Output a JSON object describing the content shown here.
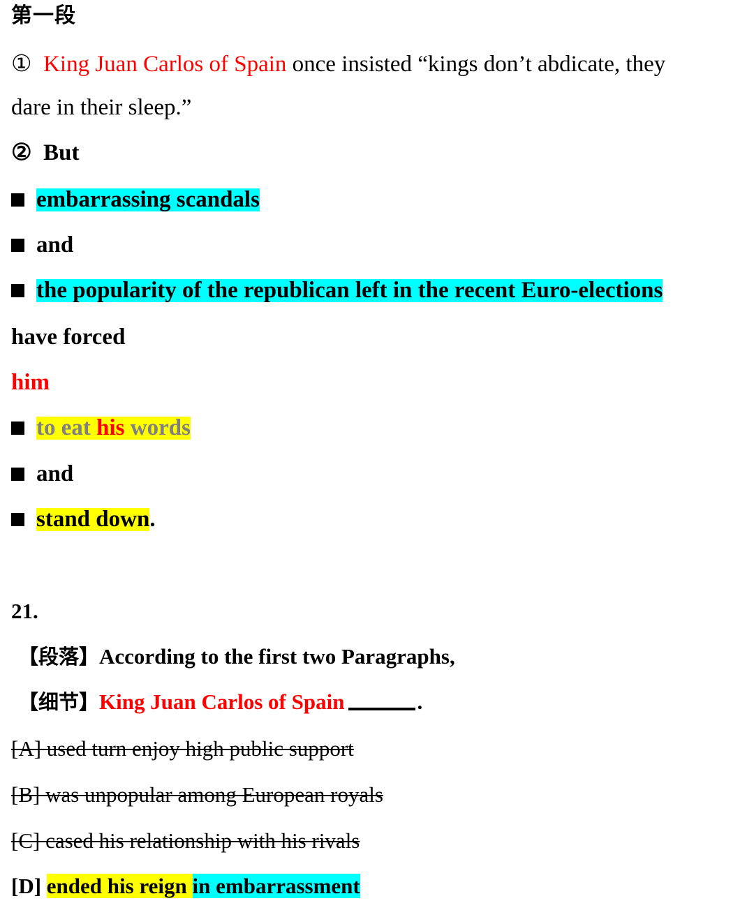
{
  "document": {
    "section_heading": "第一段",
    "colors": {
      "accent_red": "#ff0000",
      "highlight_cyan": "#00ffff",
      "highlight_yellow": "#ffff00",
      "muted_gray": "#808080",
      "text_black": "#000000"
    }
  },
  "paragraph1": {
    "marker": "①",
    "subject": "King Juan Carlos of Spain",
    "predicate": " once insisted “kings don’t abdicate, they",
    "continuation": "dare in their sleep.”"
  },
  "paragraph2": {
    "marker": "②",
    "conjunction": "But",
    "bullets": [
      {
        "text": "embarrassing scandals",
        "highlight": "cyan"
      },
      {
        "text": "and",
        "highlight": "none"
      },
      {
        "text": "the popularity of the republican left in the recent Euro-elections",
        "highlight": "cyan"
      }
    ],
    "verb_phrase": "have forced",
    "object_pronoun": "him",
    "bullets2": [
      {
        "prefix": "to eat ",
        "emphasis": "his",
        "suffix": " words",
        "highlight": "yellow"
      },
      {
        "text": "and",
        "highlight": "none"
      },
      {
        "text": "stand down",
        "trailing": ".",
        "highlight": "yellow"
      }
    ]
  },
  "question": {
    "number": "21.",
    "tag_paragraph": "【段落】",
    "stem_paragraph": "According to the first two Paragraphs,",
    "tag_detail": "【细节】",
    "stem_detail": "King Juan Carlos of Spain",
    "blank_period": ".",
    "options": [
      {
        "label": "[A]",
        "text": "used turn enjoy high public support",
        "struck": true
      },
      {
        "label": "[B]",
        "text": "was unpopular among European royals",
        "struck": true
      },
      {
        "label": "[C]",
        "text": "cased his relationship with his rivals",
        "struck": true
      },
      {
        "label": "[D]",
        "part_yellow": "ended his reign ",
        "part_cyan": "in embarrassment",
        "struck": false
      }
    ]
  }
}
